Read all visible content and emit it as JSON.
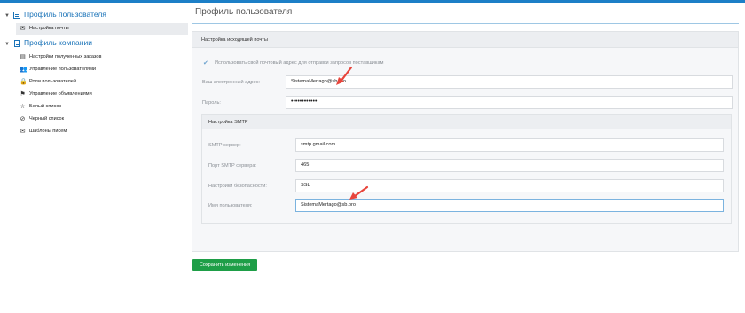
{
  "sidebar": {
    "user_profile": {
      "label": "Профиль пользователя"
    },
    "user_items": [
      {
        "label": "Настройка почты",
        "icon": "envelope-icon",
        "glyph": "✉"
      }
    ],
    "company_profile": {
      "label": "Профиль компании"
    },
    "company_items": [
      {
        "label": "Настройки полученных заказов",
        "icon": "inbox-icon",
        "glyph": "▤"
      },
      {
        "label": "Управление пользователями",
        "icon": "users-icon",
        "glyph": "👥"
      },
      {
        "label": "Роли пользователей",
        "icon": "lock-icon",
        "glyph": "🔒"
      },
      {
        "label": "Управление объявлениями",
        "icon": "flag-icon",
        "glyph": "⚑"
      },
      {
        "label": "Белый список",
        "icon": "star-icon",
        "glyph": "☆"
      },
      {
        "label": "Черный список",
        "icon": "ban-icon",
        "glyph": "⊘"
      },
      {
        "label": "Шаблоны писем",
        "icon": "mail-icon",
        "glyph": "✉"
      }
    ]
  },
  "header": {
    "title": "Профиль пользователя"
  },
  "panel": {
    "title": "Настройка исходящей почты",
    "use_own_email": {
      "label": "Использовать свой почтовый адрес для отправки запросов поставщикам",
      "checked": true
    },
    "email": {
      "label": "Ваш электронный адрес:",
      "value": "SistemaMertago@sb.pro"
    },
    "password": {
      "label": "Пароль:",
      "value": "••••••••••••"
    },
    "smtp": {
      "title": "Настройка SMTP",
      "server": {
        "label": "SMTP сервер:",
        "value": "smtp.gmail.com"
      },
      "port": {
        "label": "Порт SMTP сервера:",
        "value": "465"
      },
      "security": {
        "label": "Настройки безопасности:",
        "value": "SSL"
      },
      "username": {
        "label": "Имя пользователя:",
        "value": "SistemaMertago@sb.pro"
      }
    }
  },
  "actions": {
    "save_label": "Сохранить изменения"
  },
  "colors": {
    "accent": "#1a73b8",
    "save_button": "#1e9e47",
    "annotation_arrow": "#e8453c"
  }
}
